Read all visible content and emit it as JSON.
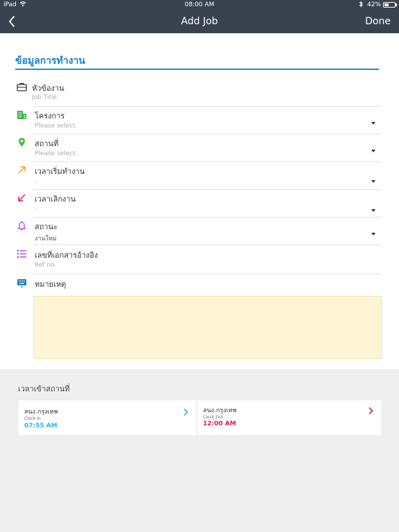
{
  "status_bar": {
    "device": "iPad",
    "time": "08:00 AM",
    "battery": "42%"
  },
  "nav": {
    "title": "Add Job",
    "done_label": "Done"
  },
  "form": {
    "section_title": "ข้อมูลการทำงาน",
    "fields": [
      {
        "label": "หัวข้องาน",
        "value": "Job Title",
        "icon": "briefcase-icon",
        "color": "#333333"
      },
      {
        "label": "โครงการ",
        "value": "Please select.",
        "icon": "building-icon",
        "color": "#3cb44b"
      },
      {
        "label": "สถานที่",
        "value": "Please select.",
        "icon": "location-pin-icon",
        "color": "#4cbb45"
      },
      {
        "label": "เวลาเริ่มทำงาน",
        "value": "-",
        "icon": "arrow-up-right-icon",
        "color": "#f39a2b"
      },
      {
        "label": "เวลาเลิกงาน",
        "value": "-",
        "icon": "arrow-down-left-icon",
        "color": "#e0185f"
      },
      {
        "label": "สถานะ",
        "value": "งานใหม่",
        "icon": "bell-icon",
        "color": "#c43be0"
      },
      {
        "label": "เลขที่เอกสารอ้างอิง",
        "value": "Ref no.",
        "icon": "list-icon",
        "color": "#b23bd8"
      },
      {
        "label": "หมายเหตุ",
        "icon": "keyboard-icon",
        "color": "#1a7fc4"
      }
    ],
    "note_bg": "#fdf5d6"
  },
  "clock": {
    "title": "เวลาเข้าสถานที่",
    "in": {
      "place": "สนง.กรุงเทพ",
      "kind": "Clock In",
      "time": "07:55 AM",
      "color": "#29b6e8"
    },
    "out": {
      "place": "สนง.กรุงเทพ",
      "kind": "Clock Out",
      "time": "12:00 AM",
      "color": "#d81b4a"
    }
  }
}
